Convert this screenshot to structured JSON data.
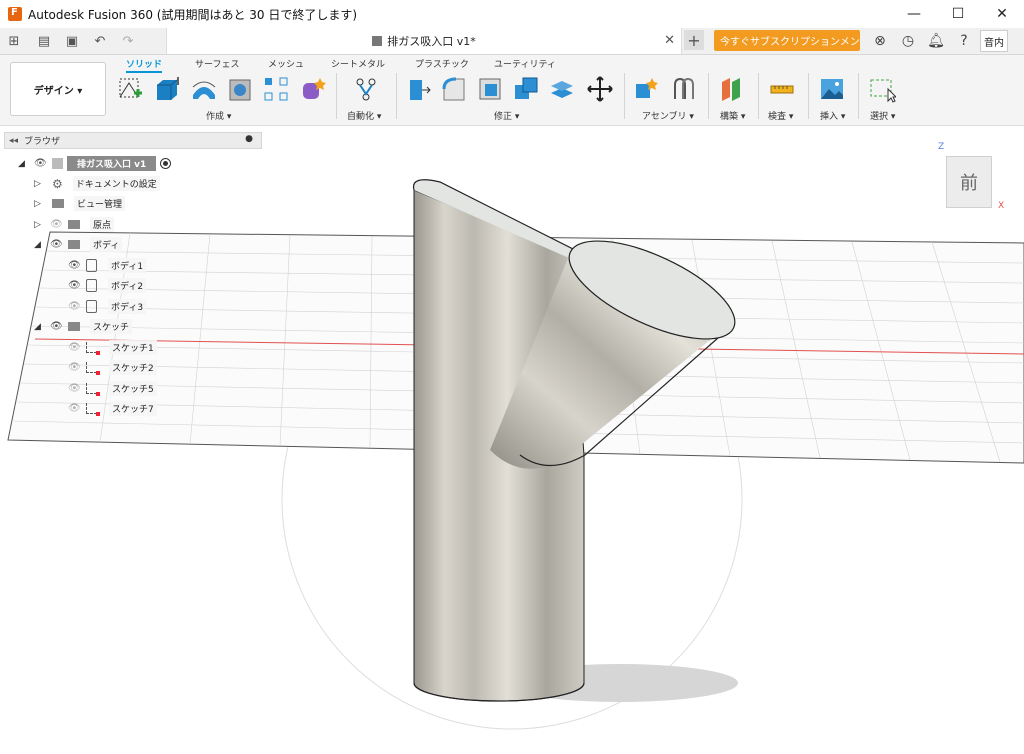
{
  "window": {
    "title": "Autodesk Fusion 360 (試用期間はあと 30 日で終了します)",
    "minimize_icon": "minimize-icon",
    "maximize_icon": "maximize-icon",
    "close_icon": "close-icon"
  },
  "topbar": {
    "doc_tab_label": "排ガス吸入口 v1*",
    "subscribe_label": "今すぐサブスクリプションメンバーに…",
    "user_label": "音内"
  },
  "ribbon": {
    "design_label": "デザイン ▾",
    "tabs": [
      "ソリッド",
      "サーフェス",
      "メッシュ",
      "シートメタル",
      "プラスチック",
      "ユーティリティ"
    ],
    "groups": [
      "作成 ▾",
      "自動化 ▾",
      "修正 ▾",
      "アセンブリ ▾",
      "構築 ▾",
      "検査 ▾",
      "挿入 ▾",
      "選択 ▾"
    ]
  },
  "browser": {
    "title": "ブラウザ",
    "root_label": "排ガス吸入口 v1",
    "items": [
      "ドキュメントの設定",
      "ビュー管理",
      "原点",
      "ボディ",
      "ボディ1",
      "ボディ2",
      "ボディ3",
      "スケッチ",
      "スケッチ1",
      "スケッチ2",
      "スケッチ5",
      "スケッチ7"
    ]
  },
  "viewcube": {
    "face_label": "前",
    "z_label": "Z",
    "x_label": "X"
  },
  "colors": {
    "accent": "#0696d7",
    "subscribe": "#f39b21",
    "x_axis": "#e35050",
    "y_axis": "#3cb043"
  }
}
